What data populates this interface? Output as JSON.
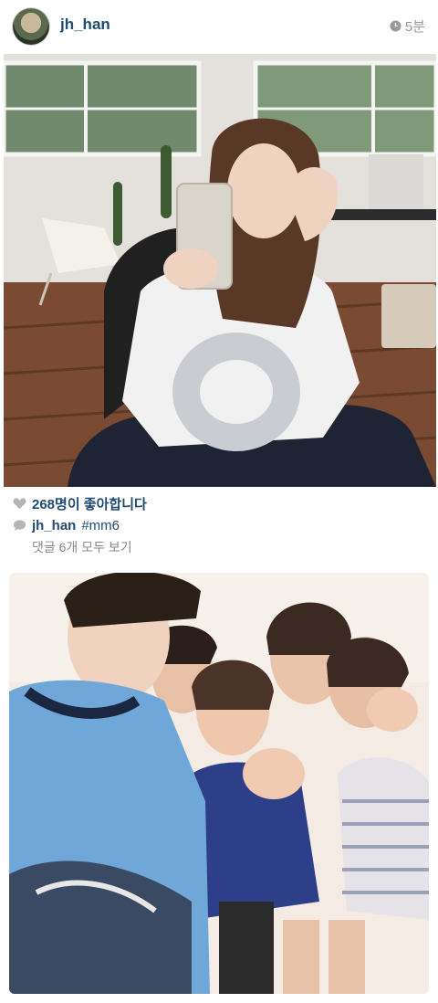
{
  "post": {
    "username": "jh_han",
    "time": "5분",
    "likes": "268명이 좋아합니다",
    "caption_user": "jh_han",
    "caption_tag": "#mm6",
    "view_comments": "댓글 6개 모두 보기"
  },
  "icons": {
    "time": "clock-icon",
    "likes": "heart-icon",
    "comments": "speech-bubble-icon"
  },
  "colors": {
    "link": "#1f4b73",
    "muted": "#8a8a8a"
  }
}
